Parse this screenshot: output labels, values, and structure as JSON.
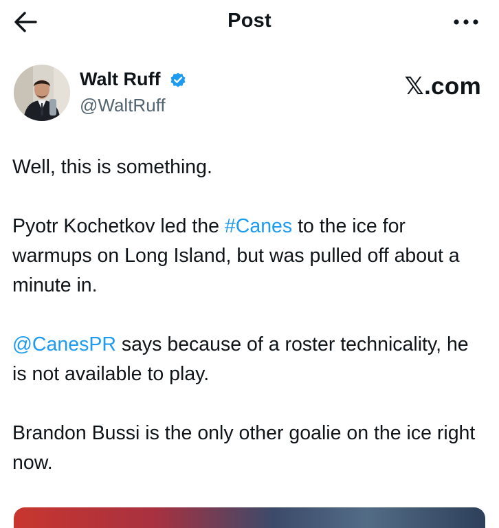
{
  "header": {
    "title": "Post",
    "back_icon": "arrow-left-icon",
    "more_icon": "more-horizontal-icon"
  },
  "author": {
    "name": "Walt Ruff",
    "handle": "@WaltRuff",
    "verified": true,
    "verified_color": "#1d9bf0"
  },
  "source": {
    "label": "𝕏.com"
  },
  "tweet": {
    "p1": "Well, this is something.",
    "p2_before": "Pyotr Kochetkov led the ",
    "p2_hashtag": "#Canes",
    "p2_after": " to the ice for warmups on Long Island, but was pulled off about a minute in.",
    "p3_mention": "@CanesPR",
    "p3_after": " says because of a roster technicality, he is not available to play.",
    "p4": "Brandon Bussi is the only other goalie on the ice right now."
  },
  "colors": {
    "link": "#1d9bf0",
    "text": "#0f1419",
    "secondary": "#536471"
  }
}
